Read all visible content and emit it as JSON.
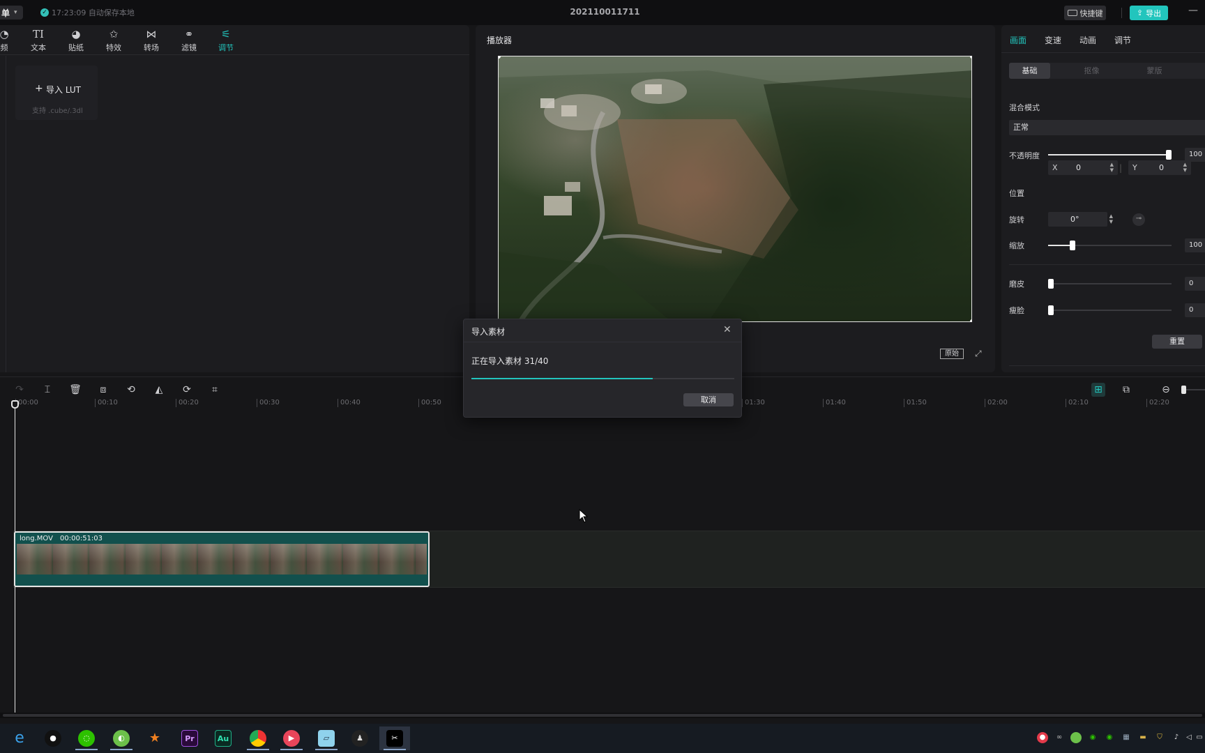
{
  "titlebar": {
    "menu_label": "单",
    "autosave_text": "17:23:09 自动保存本地",
    "project_name": "202110011711",
    "shortcut_label": "快捷键",
    "export_label": "导出"
  },
  "toolstrip": {
    "items": [
      {
        "label": "频",
        "icon": "media-icon"
      },
      {
        "label": "文本",
        "icon": "text-icon"
      },
      {
        "label": "贴纸",
        "icon": "sticker-icon"
      },
      {
        "label": "特效",
        "icon": "effects-icon"
      },
      {
        "label": "转场",
        "icon": "transition-icon"
      },
      {
        "label": "滤镜",
        "icon": "filter-icon"
      },
      {
        "label": "调节",
        "icon": "adjust-icon",
        "active": true
      }
    ]
  },
  "media": {
    "import_lut_label": "导入 LUT",
    "import_lut_sub": "支持 .cube/.3dl"
  },
  "player": {
    "title": "播放器",
    "original_label": "原始"
  },
  "props": {
    "tabs": [
      "画面",
      "变速",
      "动画",
      "调节"
    ],
    "active_tab": "画面",
    "subtabs": [
      "基础",
      "抠像",
      "蒙版"
    ],
    "active_subtab": "基础",
    "blend_mode_label": "混合模式",
    "blend_mode_value": "正常",
    "opacity_label": "不透明度",
    "opacity_value": "100",
    "position_label": "位置",
    "pos_x_axis": "X",
    "pos_x_value": "0",
    "pos_y_axis": "Y",
    "pos_y_value": "0",
    "rotation_label": "旋转",
    "rotation_value": "0°",
    "scale_label": "缩放",
    "scale_value": "100",
    "smooth_label": "磨皮",
    "smooth_value": "0",
    "slim_label": "瘦脸",
    "slim_value": "0",
    "reset_label": "重置",
    "opacity_level": 1.0,
    "scale_level": 0.2,
    "smooth_level": 0.0,
    "slim_level": 0.0
  },
  "timeline": {
    "ticks": [
      "00:00",
      "00:10",
      "00:20",
      "00:30",
      "00:40",
      "00:50",
      "01:30",
      "01:40",
      "01:50",
      "02:00",
      "02:10",
      "02:20"
    ],
    "clip_name": "long.MOV",
    "clip_duration": "00:00:51:03"
  },
  "dialog": {
    "title": "导入素材",
    "message": "正在导入素材 31/40",
    "progress": 0.69,
    "cancel_label": "取消"
  },
  "colors": {
    "accent": "#22c5bd",
    "background": "#161618",
    "panel": "#1c1c1f"
  },
  "taskbar": {
    "apps": [
      "ie-icon",
      "qq-icon",
      "wechat-icon",
      "app-green-icon",
      "app-orange-icon",
      "premiere-icon",
      "audition-icon",
      "chrome-icon",
      "recorder-icon",
      "notes-icon",
      "app-dark-icon",
      "capcut-icon"
    ],
    "pr_label": "Pr",
    "au_label": "Au"
  }
}
